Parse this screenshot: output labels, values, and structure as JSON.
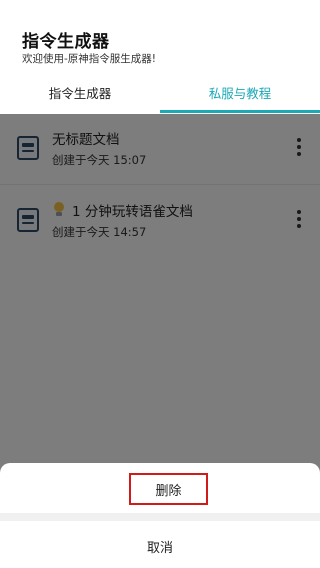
{
  "header": {
    "title": "指令生成器",
    "subtitle": "欢迎使用-原神指令服生成器!"
  },
  "tabs": [
    {
      "label": "指令生成器",
      "active": false
    },
    {
      "label": "私服与教程",
      "active": true
    }
  ],
  "accent_color": "#1ba9b6",
  "documents": [
    {
      "title": "无标题文档",
      "created": "创建于今天 15:07",
      "icon": "document-icon"
    },
    {
      "title": "1 分钟玩转语雀文档",
      "created": "创建于今天 14:57",
      "icon": "document-icon",
      "title_prefix_icon": "lightbulb-icon"
    }
  ],
  "sheet": {
    "delete_label": "删除",
    "cancel_label": "取消",
    "delete_highlight_color": "#d11a1a"
  }
}
